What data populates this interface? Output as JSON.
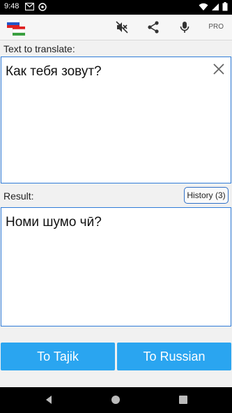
{
  "status_bar": {
    "time": "9:48",
    "left_icons": [
      "gmail-icon",
      "vpn-icon"
    ],
    "right_icons": [
      "wifi-icon",
      "signal-icon",
      "battery-icon"
    ]
  },
  "app_bar": {
    "logo": "russian-tajik-flag-icon",
    "actions": [
      "mute-icon",
      "share-icon",
      "microphone-icon"
    ],
    "pro_label": "PRO"
  },
  "input": {
    "label": "Text to translate:",
    "text": "Как тебя зовут?"
  },
  "result": {
    "label": "Result:",
    "text": "Номи шумо чӣ?",
    "history_label": "History (3)"
  },
  "buttons": {
    "to_tajik": "To Tajik",
    "to_russian": "To Russian"
  },
  "colors": {
    "accent": "#2aa5f0",
    "border": "#2f7bd8"
  }
}
